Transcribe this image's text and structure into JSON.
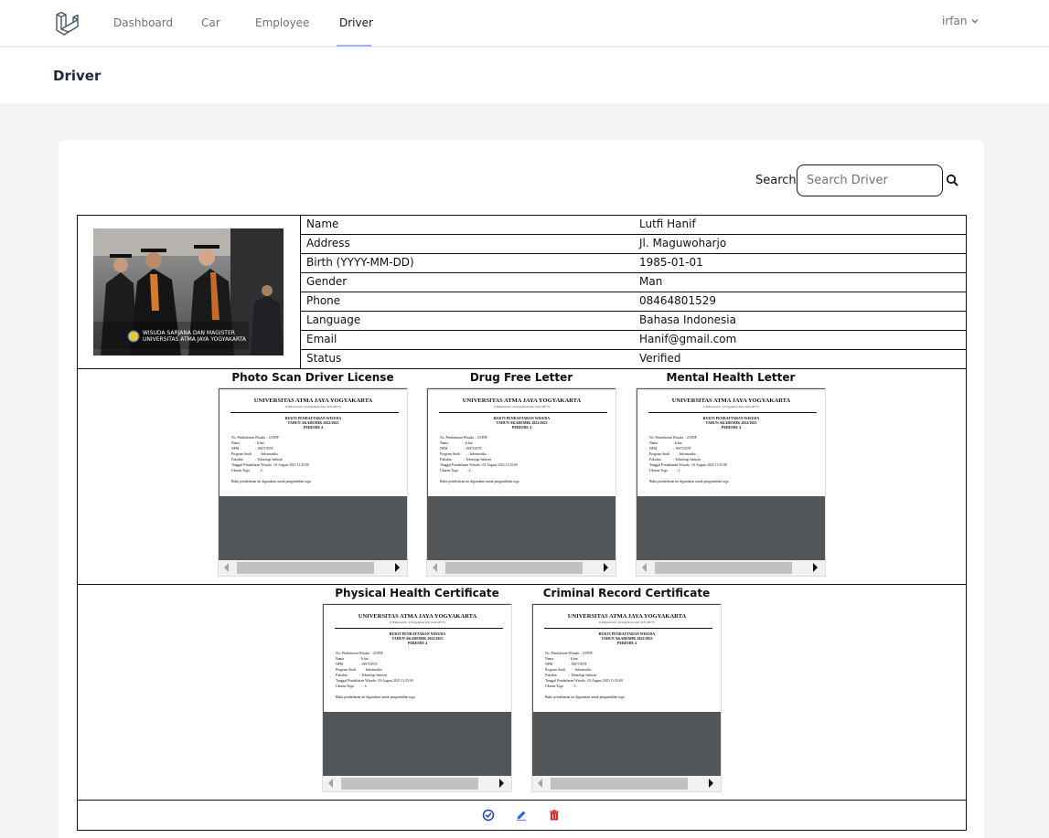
{
  "nav": {
    "links": [
      {
        "label": "Dashboard"
      },
      {
        "label": "Car"
      },
      {
        "label": "Employee"
      },
      {
        "label": "Driver"
      }
    ],
    "user": "irfan"
  },
  "header": {
    "title": "Driver"
  },
  "search": {
    "label": "Search",
    "placeholder": "Search Driver"
  },
  "driver": {
    "photo_caption": "WISUDA SARJANA DAN MAGISTER UNIVERSITAS ATMA JAYA YOGYAKARTA",
    "fields": [
      {
        "key": "Name",
        "value": "Lutfi Hanif"
      },
      {
        "key": "Address",
        "value": "Jl. Maguwoharjo"
      },
      {
        "key": "Birth (YYYY-MM-DD)",
        "value": "1985-01-01"
      },
      {
        "key": "Gender",
        "value": "Man"
      },
      {
        "key": "Phone",
        "value": "08464801529"
      },
      {
        "key": "Language",
        "value": "Bahasa Indonesia"
      },
      {
        "key": "Email",
        "value": "Hanif@gmail.com"
      },
      {
        "key": "Status",
        "value": "Verified"
      }
    ]
  },
  "documents": {
    "titles": [
      "Photo Scan Driver License",
      "Drug Free Letter",
      "Mental Health Letter",
      "Physical Health Certificate",
      "Criminal Record Certificate"
    ],
    "page": {
      "heading": "UNIVERSITAS ATMA JAYA YOGYAKARTA",
      "subheading": "Jl. Babarsari No. 44 Yogyakarta Telp. 0274-487711",
      "title_lines": "BUKTI PENDAFTARAN WISUDA\nTAHUN AKADEMIK 2022/2023\nPERIODE 4",
      "body": "No. Pendaftaran Wisuda  : 23/INF\nNama                  : Irfan\nNPM                   : 190710378\nProgram Studi         : Informatika\nFakultas              : Teknologi Industri\nTanggal Pendaftaran Wisuda : 03 August 2023 11:35:00\nUkuran Toga           : L\n\nBukti pendaftaran ini digunakan untuk pengambilan toga"
    }
  },
  "colors": {
    "accent": "#a5b4fc",
    "approve": "#1e40af",
    "edit": "#2563eb",
    "delete": "#dc2626"
  },
  "icons": [
    "logo-icon",
    "chevron-down-icon",
    "search-icon",
    "check-circle-icon",
    "pencil-icon",
    "trash-icon"
  ]
}
